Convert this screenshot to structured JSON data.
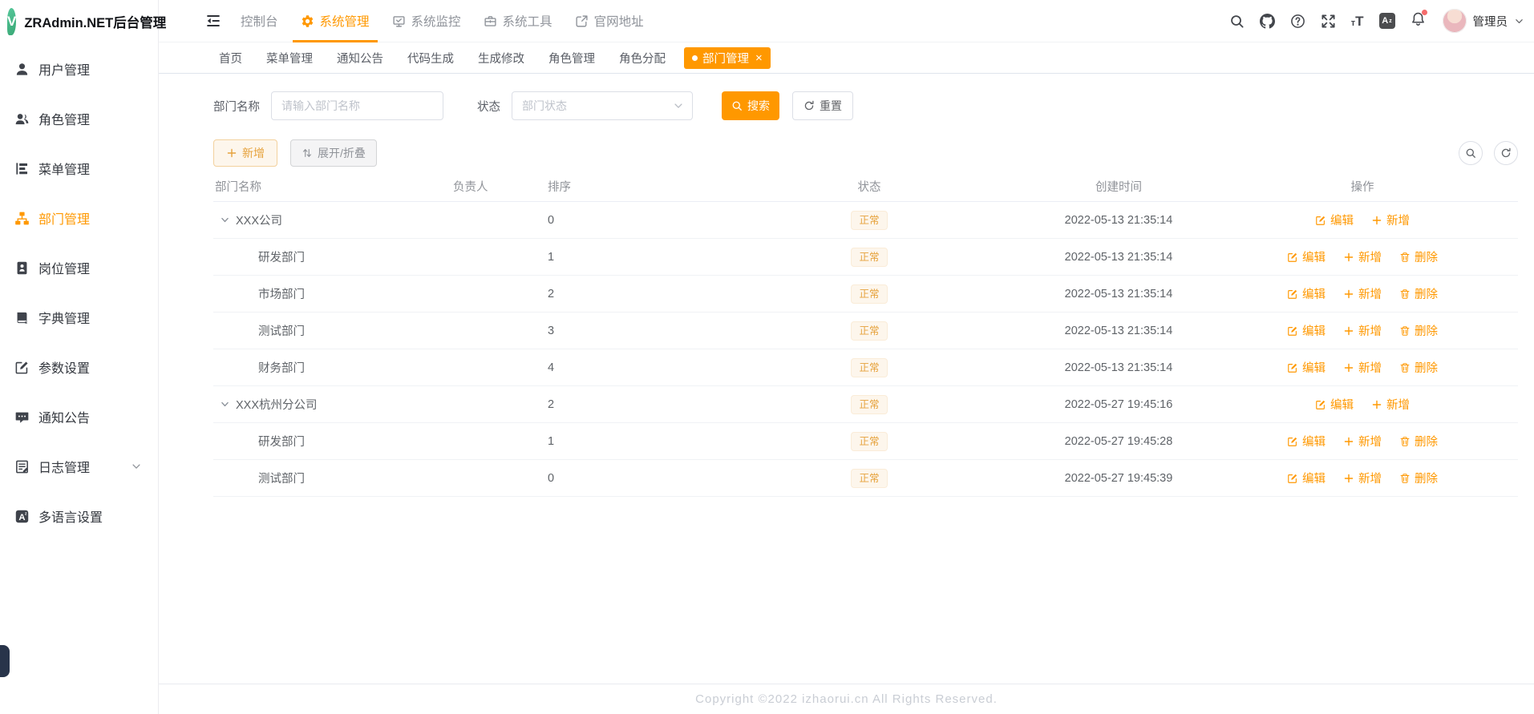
{
  "app": {
    "logo_letter": "V",
    "title": "ZRAdmin.NET后台管理"
  },
  "topnav": {
    "items": [
      {
        "key": "console",
        "label": "控制台",
        "icon": null,
        "active": false
      },
      {
        "key": "system",
        "label": "系统管理",
        "icon": "gear",
        "active": true
      },
      {
        "key": "monitor",
        "label": "系统监控",
        "icon": "monitor",
        "active": false
      },
      {
        "key": "tools",
        "label": "系统工具",
        "icon": "briefcase",
        "active": false
      },
      {
        "key": "website",
        "label": "官网地址",
        "icon": "external-link",
        "active": false
      }
    ],
    "user": {
      "name": "管理员"
    }
  },
  "sidebar": {
    "items": [
      {
        "key": "users",
        "label": "用户管理",
        "icon": "user",
        "active": false
      },
      {
        "key": "roles",
        "label": "角色管理",
        "icon": "users",
        "active": false
      },
      {
        "key": "menus",
        "label": "菜单管理",
        "icon": "menu-tree",
        "active": false
      },
      {
        "key": "depts",
        "label": "部门管理",
        "icon": "org-tree",
        "active": true
      },
      {
        "key": "posts",
        "label": "岗位管理",
        "icon": "badge",
        "active": false
      },
      {
        "key": "dicts",
        "label": "字典管理",
        "icon": "book",
        "active": false
      },
      {
        "key": "params",
        "label": "参数设置",
        "icon": "edit-square",
        "active": false
      },
      {
        "key": "notices",
        "label": "通知公告",
        "icon": "chat",
        "active": false
      },
      {
        "key": "logs",
        "label": "日志管理",
        "icon": "log",
        "active": false,
        "has_children": true
      },
      {
        "key": "i18n",
        "label": "多语言设置",
        "icon": "language",
        "active": false
      }
    ]
  },
  "tabs": {
    "items": [
      {
        "key": "home",
        "label": "首页",
        "active": false
      },
      {
        "key": "menus",
        "label": "菜单管理",
        "active": false
      },
      {
        "key": "notices",
        "label": "通知公告",
        "active": false
      },
      {
        "key": "codegen",
        "label": "代码生成",
        "active": false
      },
      {
        "key": "genedit",
        "label": "生成修改",
        "active": false
      },
      {
        "key": "roles",
        "label": "角色管理",
        "active": false
      },
      {
        "key": "roleassign",
        "label": "角色分配",
        "active": false
      },
      {
        "key": "depts",
        "label": "部门管理",
        "active": true,
        "closable": true
      }
    ]
  },
  "filters": {
    "dept_name_label": "部门名称",
    "dept_name_placeholder": "请输入部门名称",
    "dept_name_value": "",
    "status_label": "状态",
    "status_placeholder": "部门状态",
    "search_button": "搜索",
    "reset_button": "重置"
  },
  "toolbar": {
    "add_button": "新增",
    "expand_button": "展开/折叠"
  },
  "table": {
    "columns": [
      {
        "key": "name",
        "label": "部门名称"
      },
      {
        "key": "manager",
        "label": "负责人"
      },
      {
        "key": "sort",
        "label": "排序"
      },
      {
        "key": "status",
        "label": "状态"
      },
      {
        "key": "created",
        "label": "创建时间"
      },
      {
        "key": "actions",
        "label": "操作"
      }
    ],
    "action_sets": {
      "parent": [
        {
          "icon": "edit",
          "label": "编辑"
        },
        {
          "icon": "plus",
          "label": "新增"
        }
      ],
      "child": [
        {
          "icon": "edit",
          "label": "编辑"
        },
        {
          "icon": "plus",
          "label": "新增"
        },
        {
          "icon": "trash",
          "label": "删除"
        }
      ]
    },
    "rows": [
      {
        "name": "XXX公司",
        "level": 0,
        "expanded": true,
        "manager": "",
        "sort": "0",
        "status": "正常",
        "created": "2022-05-13 21:35:14",
        "actions": "parent"
      },
      {
        "name": "研发部门",
        "level": 1,
        "manager": "",
        "sort": "1",
        "status": "正常",
        "created": "2022-05-13 21:35:14",
        "actions": "child"
      },
      {
        "name": "市场部门",
        "level": 1,
        "manager": "",
        "sort": "2",
        "status": "正常",
        "created": "2022-05-13 21:35:14",
        "actions": "child"
      },
      {
        "name": "测试部门",
        "level": 1,
        "manager": "",
        "sort": "3",
        "status": "正常",
        "created": "2022-05-13 21:35:14",
        "actions": "child"
      },
      {
        "name": "财务部门",
        "level": 1,
        "manager": "",
        "sort": "4",
        "status": "正常",
        "created": "2022-05-13 21:35:14",
        "actions": "child"
      },
      {
        "name": "XXX杭州分公司",
        "level": 0,
        "expanded": true,
        "manager": "",
        "sort": "2",
        "status": "正常",
        "created": "2022-05-27 19:45:16",
        "actions": "parent"
      },
      {
        "name": "研发部门",
        "level": 1,
        "manager": "",
        "sort": "1",
        "status": "正常",
        "created": "2022-05-27 19:45:28",
        "actions": "child"
      },
      {
        "name": "测试部门",
        "level": 1,
        "manager": "",
        "sort": "0",
        "status": "正常",
        "created": "2022-05-27 19:45:39",
        "actions": "child"
      }
    ]
  },
  "footer": {
    "copyright": "Copyright ©2022 izhaorui.cn All Rights Reserved."
  },
  "colors": {
    "accent": "#ff9800",
    "warning_text": "#e6a23c",
    "badge_bg": "#fdf6ec",
    "sidebar_active": "#ff9800"
  }
}
